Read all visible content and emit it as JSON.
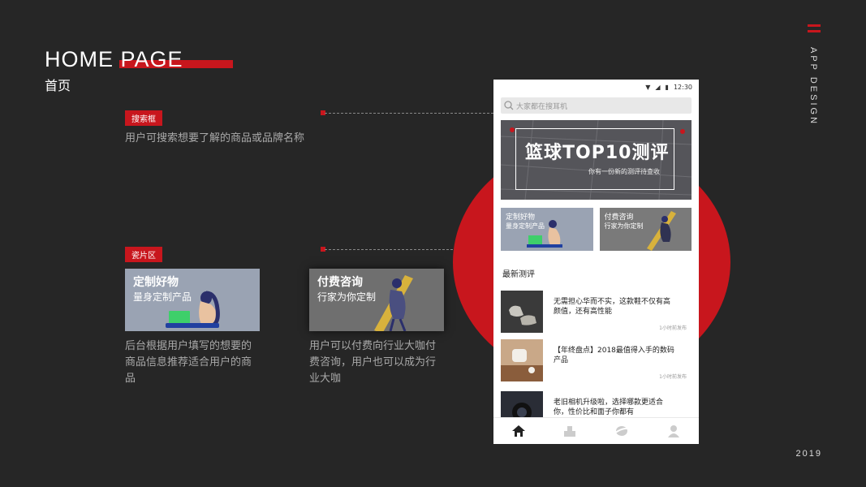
{
  "header": {
    "title_en": "HOME PAGE",
    "title_zh": "首页"
  },
  "side": {
    "label": "APP DESIGN",
    "year": "2019"
  },
  "annotations": {
    "search": {
      "tag": "搜索框",
      "desc": "用户可搜索想要了解的商品或品牌名称"
    },
    "tiles": {
      "tag": "瓷片区"
    }
  },
  "tiles": [
    {
      "title": "定制好物",
      "subtitle": "量身定制产品",
      "desc": "后台根据用户填写的想要的商品信息推荐适合用户的商品"
    },
    {
      "title": "付费咨询",
      "subtitle": "行家为你定制",
      "desc": "用户可以付费向行业大咖付费咨询，用户也可以成为行业大咖"
    }
  ],
  "phone": {
    "time": "12:30",
    "search_placeholder": "大家都在搜耳机",
    "banner_title": "篮球TOP10测评",
    "banner_sub": "你有一份新的测评待查收",
    "tiles": [
      {
        "title": "定制好物",
        "subtitle": "量身定制产品"
      },
      {
        "title": "付费咨询",
        "subtitle": "行家为你定制"
      }
    ],
    "section_title": "最新测评",
    "articles": [
      {
        "text": "无需担心华而不实，这款鞋不仅有高颜值，还有高性能",
        "time": "1小时前发布"
      },
      {
        "text": "【年终盘点】2018最值得入手的数码产品",
        "time": "1小时前发布"
      },
      {
        "text": "老旧相机升级啦，选择哪款更适合你，性价比和面子你都有",
        "time": ""
      }
    ],
    "tabs": [
      "home-icon",
      "category-icon",
      "discover-icon",
      "profile-icon"
    ]
  },
  "colors": {
    "accent": "#c8161d",
    "background": "#262626"
  }
}
